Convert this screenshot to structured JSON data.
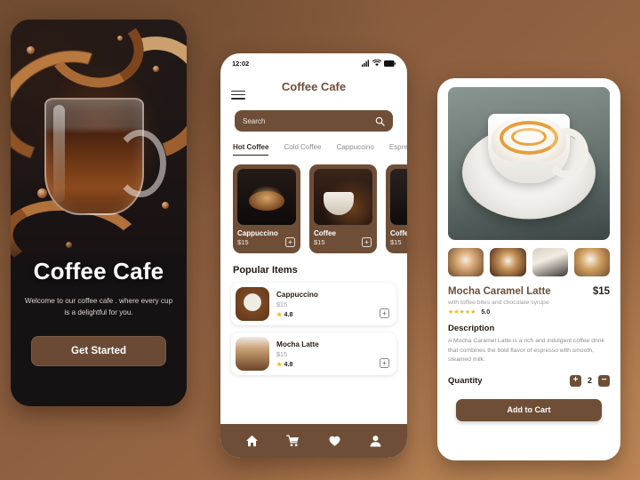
{
  "theme": {
    "brand_brown": "#6f4e37",
    "button_brown": "#6b4a35",
    "star_yellow": "#f2b90c",
    "background": "#8e6040"
  },
  "splash": {
    "title": "Coffee Cafe",
    "subtitle": "Welcome to our coffee cafe . where every cup is a delightful for you.",
    "cta_label": "Get Started"
  },
  "home": {
    "status": {
      "time": "12:02",
      "signal": "signal-icon",
      "wifi": "wifi-icon",
      "battery": "battery-icon"
    },
    "app_title": "Coffee Cafe",
    "menu_icon": "hamburger-icon",
    "search": {
      "placeholder": "Search",
      "value": "",
      "icon": "search-icon"
    },
    "tabs": [
      {
        "label": "Hot Coffee",
        "active": true
      },
      {
        "label": "Cold Coffee",
        "active": false
      },
      {
        "label": "Cappuccino",
        "active": false
      },
      {
        "label": "Espre",
        "active": false
      }
    ],
    "cards": [
      {
        "name": "Cappuccino",
        "price": "$15",
        "add": "+"
      },
      {
        "name": "Coffee",
        "price": "$15",
        "add": "+"
      },
      {
        "name": "Coffee",
        "price": "$15",
        "add": "+"
      }
    ],
    "popular_heading": "Popular Items",
    "popular_items": [
      {
        "name": "Cappuccino",
        "price": "$15",
        "rating": "4.8",
        "add": "+"
      },
      {
        "name": "Mocha Latte",
        "price": "$15",
        "rating": "4.8",
        "add": "+"
      }
    ],
    "nav": [
      {
        "name": "home-icon"
      },
      {
        "name": "cart-icon"
      },
      {
        "name": "heart-icon"
      },
      {
        "name": "profile-icon"
      }
    ]
  },
  "detail": {
    "product_name": "Mocha Caramel Latte",
    "price": "$15",
    "subtitle": "with toffee bites and chocolate syrupe",
    "stars": "★★★★★",
    "rating": "5.0",
    "description_heading": "Description",
    "description": "A Mocha Caramel Latte is a rich and indulgent coffee drink that combines the bold flavor of espresso with smooth, steamed milk.",
    "quantity_label": "Quantity",
    "quantity_value": "2",
    "increment": "+",
    "decrement": "−",
    "add_to_cart": "Add to Cart"
  }
}
